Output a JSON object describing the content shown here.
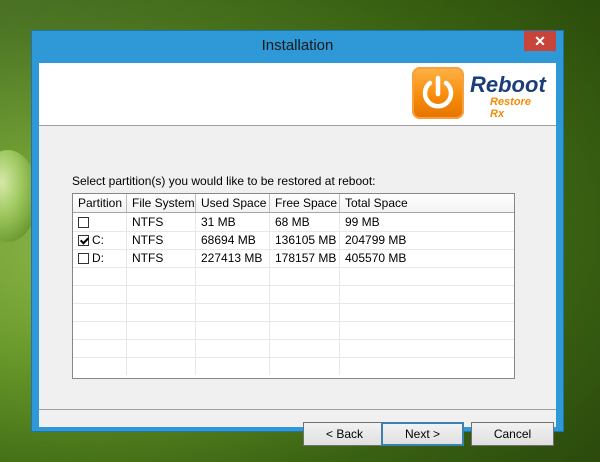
{
  "window": {
    "title": "Installation",
    "close_label": "✕"
  },
  "logo": {
    "name": "Reboot",
    "sub": "Restore Rx",
    "icon": "power-icon",
    "accent": "#f58a07",
    "brand": "#1c3e78"
  },
  "prompt": "Select partition(s) you would like to be restored at reboot:",
  "table": {
    "columns": [
      "Partition",
      "File System",
      "Used Space",
      "Free Space",
      "Total Space"
    ],
    "rows": [
      {
        "checked": false,
        "partition": "",
        "fs": "NTFS",
        "used": "31 MB",
        "free": "68 MB",
        "total": "99 MB"
      },
      {
        "checked": true,
        "partition": "C:",
        "fs": "NTFS",
        "used": "68694 MB",
        "free": "136105 MB",
        "total": "204799 MB"
      },
      {
        "checked": false,
        "partition": "D:",
        "fs": "NTFS",
        "used": "227413 MB",
        "free": "178157 MB",
        "total": "405570 MB"
      }
    ]
  },
  "buttons": {
    "back": "< Back",
    "next": "Next >",
    "cancel": "Cancel"
  }
}
